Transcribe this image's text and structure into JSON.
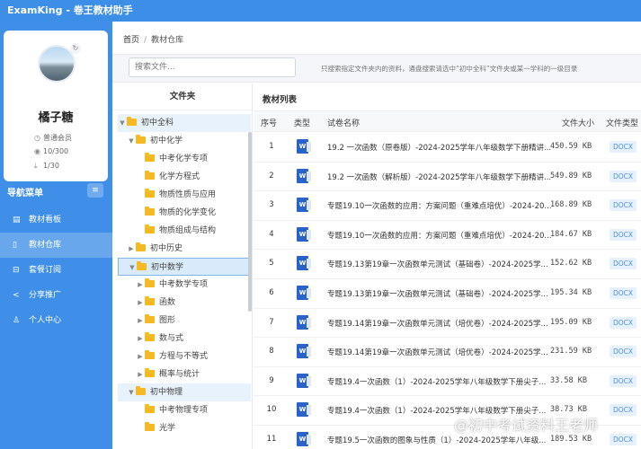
{
  "app": {
    "title": "ExamKing - 卷王教材助手"
  },
  "profile": {
    "username": "橘子糖",
    "membership": "普通会员",
    "views": "10/300",
    "downloads": "1/30"
  },
  "nav": {
    "header": "导航菜单",
    "items": [
      {
        "label": "教材看板",
        "icon": "chart-icon"
      },
      {
        "label": "教材仓库",
        "icon": "document-icon",
        "active": true
      },
      {
        "label": "套餐订阅",
        "icon": "cart-icon"
      },
      {
        "label": "分享推广",
        "icon": "share-icon"
      },
      {
        "label": "个人中心",
        "icon": "user-icon"
      }
    ]
  },
  "breadcrumb": {
    "home": "首页",
    "separator": "/",
    "current": "教材仓库"
  },
  "search": {
    "placeholder": "搜索文件...",
    "hint": "只搜索指定文件夹内的资料，通盘搜索请选中“初中全科”文件夹或某一学科的一级目录"
  },
  "folders": {
    "header": "文件夹",
    "tree": [
      {
        "label": "初中全科",
        "level": 0,
        "expanded": true
      },
      {
        "label": "初中化学",
        "level": 1,
        "expanded": true
      },
      {
        "label": "中考化学专项",
        "level": 2
      },
      {
        "label": "化学方程式",
        "level": 2
      },
      {
        "label": "物质性质与应用",
        "level": 2
      },
      {
        "label": "物质的化学变化",
        "level": 2
      },
      {
        "label": "物质组成与结构",
        "level": 2
      },
      {
        "label": "初中历史",
        "level": 1,
        "expanded": false
      },
      {
        "label": "初中数学",
        "level": 1,
        "expanded": true,
        "selected": true
      },
      {
        "label": "中考数学专项",
        "level": 2,
        "expanded": false
      },
      {
        "label": "函数",
        "level": 2,
        "expanded": false
      },
      {
        "label": "图形",
        "level": 2,
        "expanded": false
      },
      {
        "label": "数与式",
        "level": 2,
        "expanded": false
      },
      {
        "label": "方程与不等式",
        "level": 2,
        "expanded": false
      },
      {
        "label": "概率与统计",
        "level": 2,
        "expanded": false
      },
      {
        "label": "初中物理",
        "level": 1,
        "expanded": true
      },
      {
        "label": "中考物理专项",
        "level": 2
      },
      {
        "label": "光学",
        "level": 2
      }
    ]
  },
  "files": {
    "title": "教材列表",
    "columns": [
      "序号",
      "类型",
      "试卷名称",
      "文件大小",
      "文件类型"
    ],
    "rows": [
      {
        "no": "1",
        "name": "19.2 一次函数（原卷版）-2024-2025学年八年级数学下册精讲...",
        "size": "450.59 KB",
        "type": "DOCX"
      },
      {
        "no": "2",
        "name": "19.2 一次函数（解析版）-2024-2025学年八年级数学下册精讲...",
        "size": "549.89 KB",
        "type": "DOCX"
      },
      {
        "no": "3",
        "name": "专题19.10一次函数的应用：方案问题（重难点培优）-2024-20...",
        "size": "168.89 KB",
        "type": "DOCX"
      },
      {
        "no": "4",
        "name": "专题19.10一次函数的应用：方案问题（重难点培优）-2024-20...",
        "size": "184.67 KB",
        "type": "DOCX"
      },
      {
        "no": "5",
        "name": "专题19.13第19章一次函数单元测试（基础卷）-2024-2025学...",
        "size": "152.62 KB",
        "type": "DOCX"
      },
      {
        "no": "6",
        "name": "专题19.13第19章一次函数单元测试（基础卷）-2024-2025学...",
        "size": "195.34 KB",
        "type": "DOCX"
      },
      {
        "no": "7",
        "name": "专题19.14第19章一次函数单元测试（培优卷）-2024-2025学...",
        "size": "195.09 KB",
        "type": "DOCX"
      },
      {
        "no": "8",
        "name": "专题19.14第19章一次函数单元测试（培优卷）-2024-2025学...",
        "size": "231.59 KB",
        "type": "DOCX"
      },
      {
        "no": "9",
        "name": "专题19.4一次函数（1）-2024-2025学年八年级数学下册尖子...",
        "size": "33.58 KB",
        "type": "DOCX"
      },
      {
        "no": "10",
        "name": "专题19.4一次函数（1）-2024-2025学年八年级数学下册尖子...",
        "size": "38.73 KB",
        "type": "DOCX"
      },
      {
        "no": "11",
        "name": "专题19.5一次函数的图象与性质（1）-2024-2025学年八年级...",
        "size": "189.53 KB",
        "type": "DOCX"
      }
    ]
  },
  "watermark": "@初中考试资料王老师",
  "colors": {
    "primary": "#3f8fe8",
    "folder": "#f5b921",
    "word": "#2b62c9",
    "badge_bg": "#e6f1fc"
  }
}
